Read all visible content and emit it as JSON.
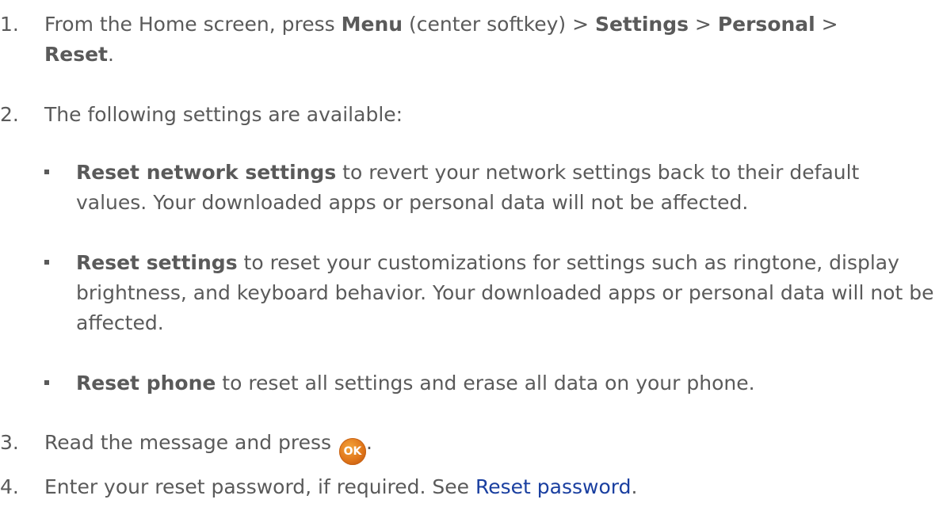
{
  "steps": [
    {
      "number": "1.",
      "pre": "From the Home screen, press ",
      "menu": "Menu",
      "mid1": " (center softkey) > ",
      "settings": "Settings",
      "gt1": " > ",
      "personal": "Personal",
      "gt2": " >",
      "reset": "Reset",
      "end": "."
    },
    {
      "number": "2.",
      "text": "The following settings are available:"
    },
    {
      "number": "3.",
      "pre": "Read the message and press ",
      "button_label": "OK",
      "end": "."
    },
    {
      "number": "4.",
      "pre": "Enter your reset password, if required. See ",
      "link": "Reset password",
      "end": "."
    }
  ],
  "bullets": [
    {
      "bold": "Reset network settings",
      "text": " to revert your network settings back to their default values. Your downloaded apps or personal data will not be affected."
    },
    {
      "bold": "Reset settings",
      "text": " to reset your customizations for settings such as ringtone, display brightness, and keyboard behavior. Your downloaded apps or personal data will not be affected."
    },
    {
      "bold": "Reset phone",
      "text": " to reset all settings and erase all data on your phone."
    }
  ],
  "colors": {
    "text": "#5a5a5a",
    "link": "#1a3fa0",
    "ok_button": "#e0761a"
  },
  "icons": {
    "ok_button": "ok-button-icon",
    "bullet": "square-bullet-icon"
  }
}
